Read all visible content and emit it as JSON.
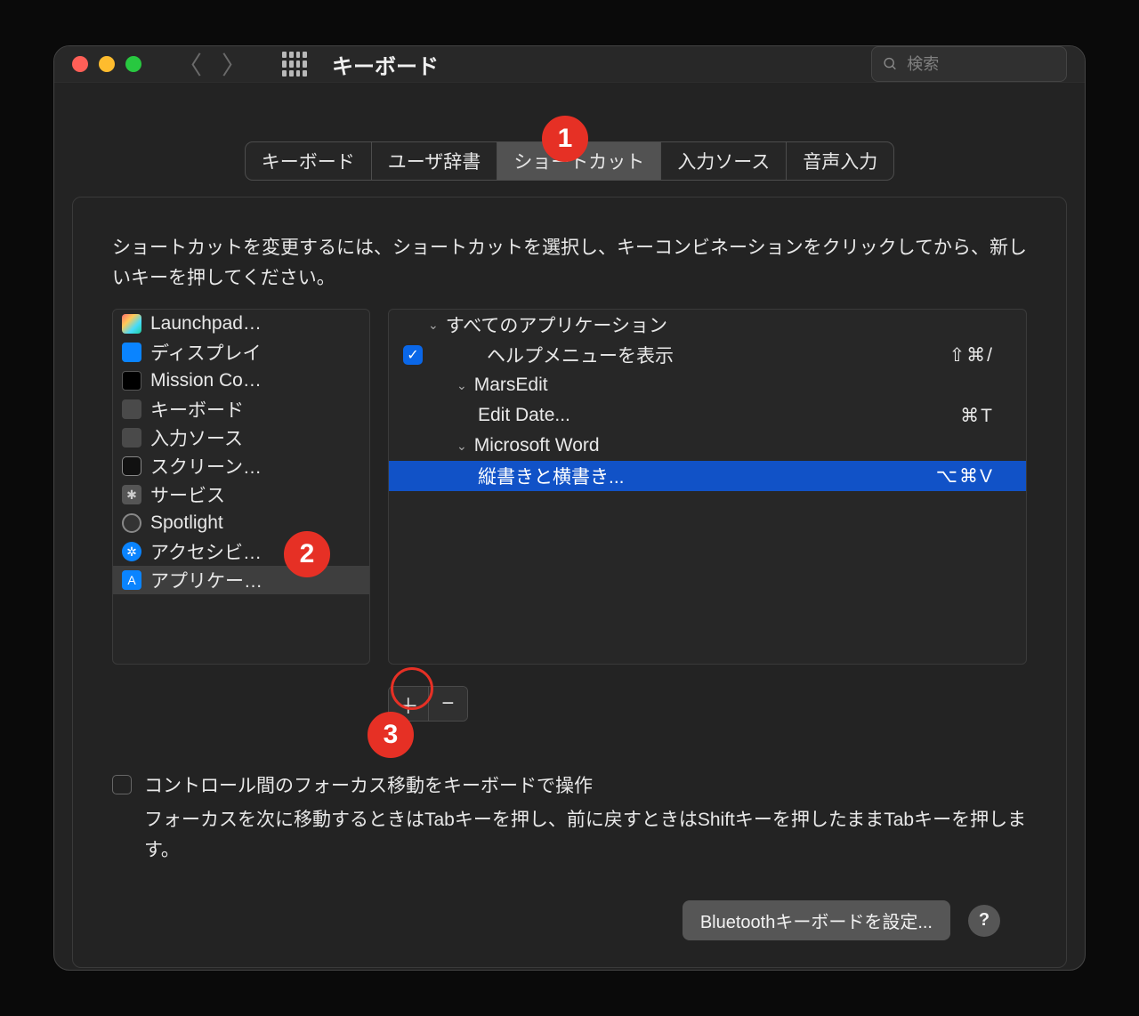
{
  "window": {
    "title": "キーボード",
    "search_placeholder": "検索"
  },
  "tabs": [
    {
      "label": "キーボード",
      "active": false
    },
    {
      "label": "ユーザ辞書",
      "active": false
    },
    {
      "label": "ショートカット",
      "active": true
    },
    {
      "label": "入力ソース",
      "active": false
    },
    {
      "label": "音声入力",
      "active": false
    }
  ],
  "instruction": "ショートカットを変更するには、ショートカットを選択し、キーコンビネーションをクリックしてから、新しいキーを押してください。",
  "sidebar": {
    "items": [
      {
        "label": "Launchpad…",
        "icon": "launchpad-icon",
        "cls": "icon-launchpad"
      },
      {
        "label": "ディスプレイ",
        "icon": "display-icon",
        "cls": "icon-display"
      },
      {
        "label": "Mission Co…",
        "icon": "mission-control-icon",
        "cls": "icon-mission"
      },
      {
        "label": "キーボード",
        "icon": "keyboard-icon",
        "cls": "icon-keyboard"
      },
      {
        "label": "入力ソース",
        "icon": "input-source-icon",
        "cls": "icon-input"
      },
      {
        "label": "スクリーン…",
        "icon": "screenshot-icon",
        "cls": "icon-screen"
      },
      {
        "label": "サービス",
        "icon": "services-icon",
        "cls": "icon-services",
        "glyph": "✱"
      },
      {
        "label": "Spotlight",
        "icon": "spotlight-icon",
        "cls": "icon-spotlight"
      },
      {
        "label": "アクセシビ…",
        "icon": "accessibility-icon",
        "cls": "icon-access",
        "glyph": "✲"
      },
      {
        "label": "アプリケー…",
        "icon": "applications-icon",
        "cls": "icon-apps",
        "glyph": "A",
        "selected": true
      }
    ]
  },
  "shortcuts": {
    "groups": [
      {
        "name": "すべてのアプリケーション",
        "level": "top",
        "items": [
          {
            "label": "ヘルプメニューを表示",
            "keys": "⇧⌘/",
            "checked": true
          }
        ]
      },
      {
        "name": "MarsEdit",
        "level": "sub",
        "items": [
          {
            "label": "Edit Date...",
            "keys": "⌘T"
          }
        ]
      },
      {
        "name": "Microsoft Word",
        "level": "sub",
        "items": [
          {
            "label": "縦書きと横書き...",
            "keys": "⌥⌘V",
            "selected": true
          }
        ]
      }
    ]
  },
  "focus": {
    "label": "コントロール間のフォーカス移動をキーボードで操作",
    "help": "フォーカスを次に移動するときはTabキーを押し、前に戻すときはShiftキーを押したままTabキーを押します。"
  },
  "footer": {
    "bluetooth_button": "Bluetoothキーボードを設定..."
  },
  "annotations": {
    "b1": "1",
    "b2": "2",
    "b3": "3"
  }
}
